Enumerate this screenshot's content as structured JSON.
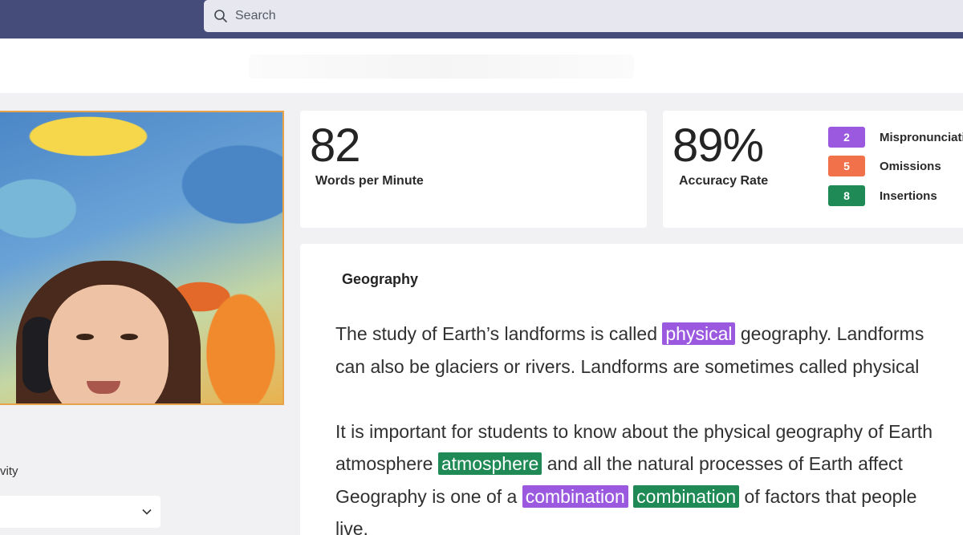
{
  "search": {
    "placeholder": "Search"
  },
  "left_panel": {
    "label": "vity"
  },
  "metrics": {
    "wpm": {
      "value": "82",
      "label": "Words per Minute"
    },
    "accuracy": {
      "value": "89%",
      "label": "Accuracy Rate"
    }
  },
  "stats": [
    {
      "count": "2",
      "label": "Mispronunciations",
      "color": "#9b59e0"
    },
    {
      "count": "5",
      "label": "Omissions",
      "color": "#f0714a"
    },
    {
      "count": "8",
      "label": "Insertions",
      "color": "#1f8a55"
    }
  ],
  "passage": {
    "title": "Geography",
    "p1": {
      "l1_a": "The study of Earth’s landforms is called ",
      "l1_hl": "physical",
      "l1_b": " geography. Landforms",
      "l2": "can also be glaciers or rivers. Landforms are sometimes called physical"
    },
    "p2": {
      "l1": "It is important for students to know about the physical geography of Earth",
      "l2_a": "atmosphere ",
      "l2_hl": "atmosphere",
      "l2_b": " and all the natural processes of Earth affect",
      "l3_a": "Geography is one of a ",
      "l3_hl1": "combination",
      "l3_hl2": "combination",
      "l3_b": " of factors that people",
      "l4": "live."
    }
  },
  "colors": {
    "accent_bar": "#464c7a",
    "mispronunciation": "#9b59e0",
    "omission": "#f0714a",
    "insertion": "#1f8a55"
  }
}
